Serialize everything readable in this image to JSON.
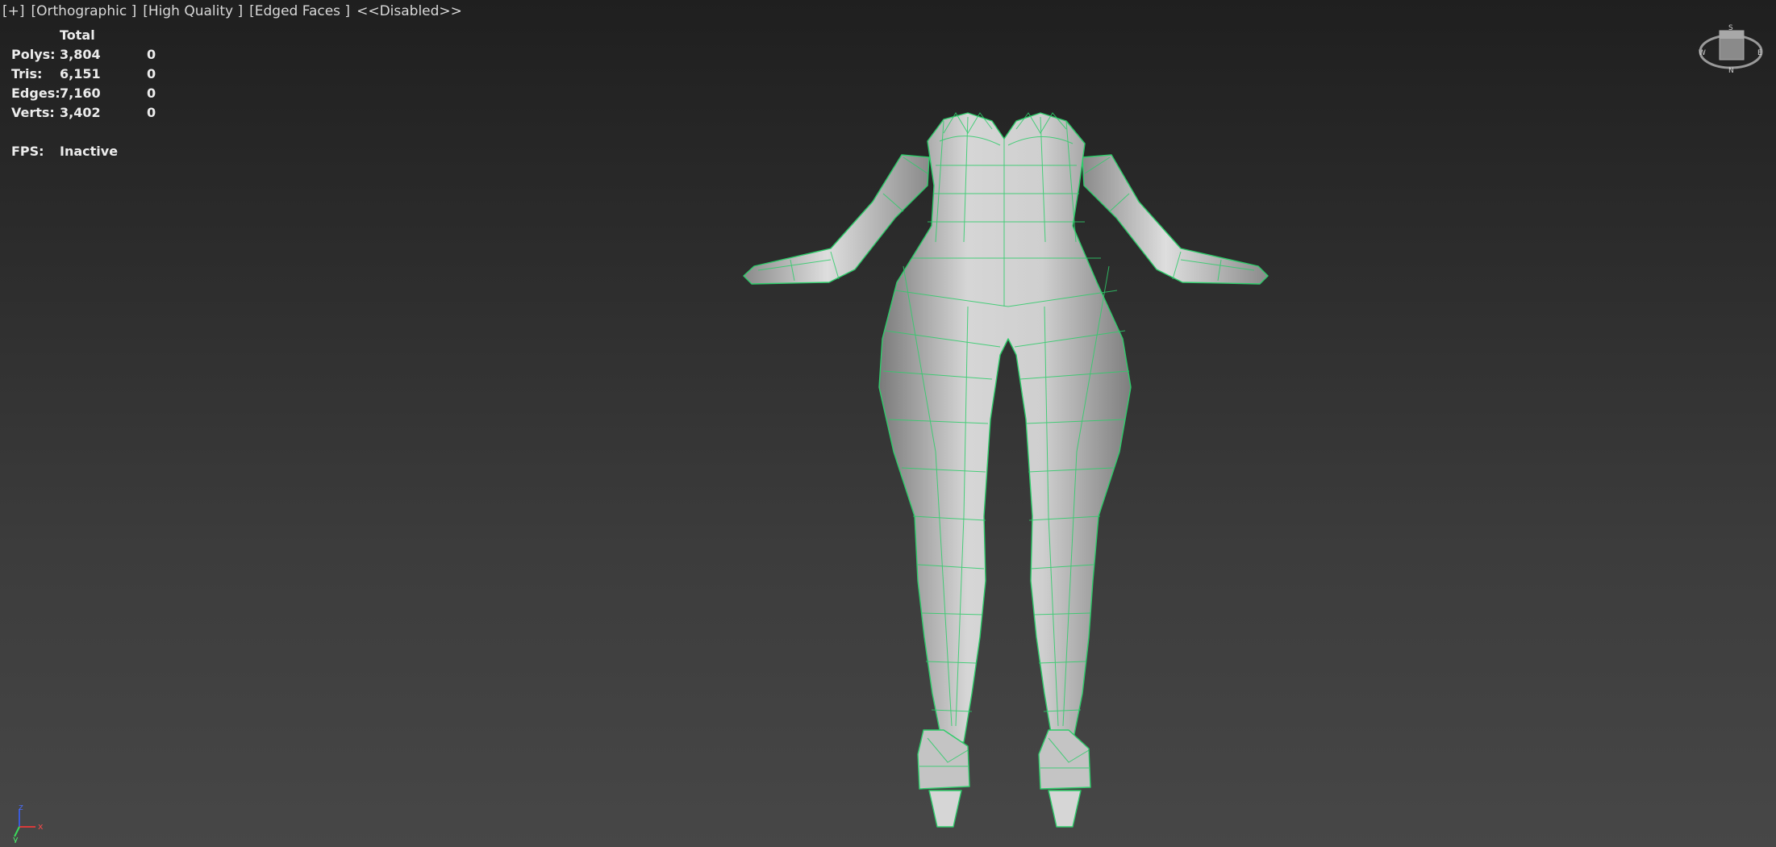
{
  "viewport": {
    "labels": {
      "plus": "[+]",
      "view": "[Orthographic ]",
      "quality": "[High Quality ]",
      "shading": "[Edged Faces ]",
      "extra": "<<Disabled>>"
    }
  },
  "stats": {
    "header_total": "Total",
    "rows": [
      {
        "label": "Polys:",
        "total": "3,804",
        "selected": "0"
      },
      {
        "label": "Tris:",
        "total": "6,151",
        "selected": "0"
      },
      {
        "label": "Edges:",
        "total": "7,160",
        "selected": "0"
      },
      {
        "label": "Verts:",
        "total": "3,402",
        "selected": "0"
      }
    ],
    "fps_label": "FPS:",
    "fps_value": "Inactive"
  },
  "viewcube": {
    "compass": [
      "S",
      "W",
      "E",
      "N"
    ]
  },
  "axis": {
    "labels": [
      "z",
      "x",
      "y"
    ]
  },
  "colors": {
    "wireframe": "#2ecc6a",
    "mesh_fill": "#cfcfcf",
    "background_top": "#1f1f1f",
    "background_bottom": "#474747"
  }
}
